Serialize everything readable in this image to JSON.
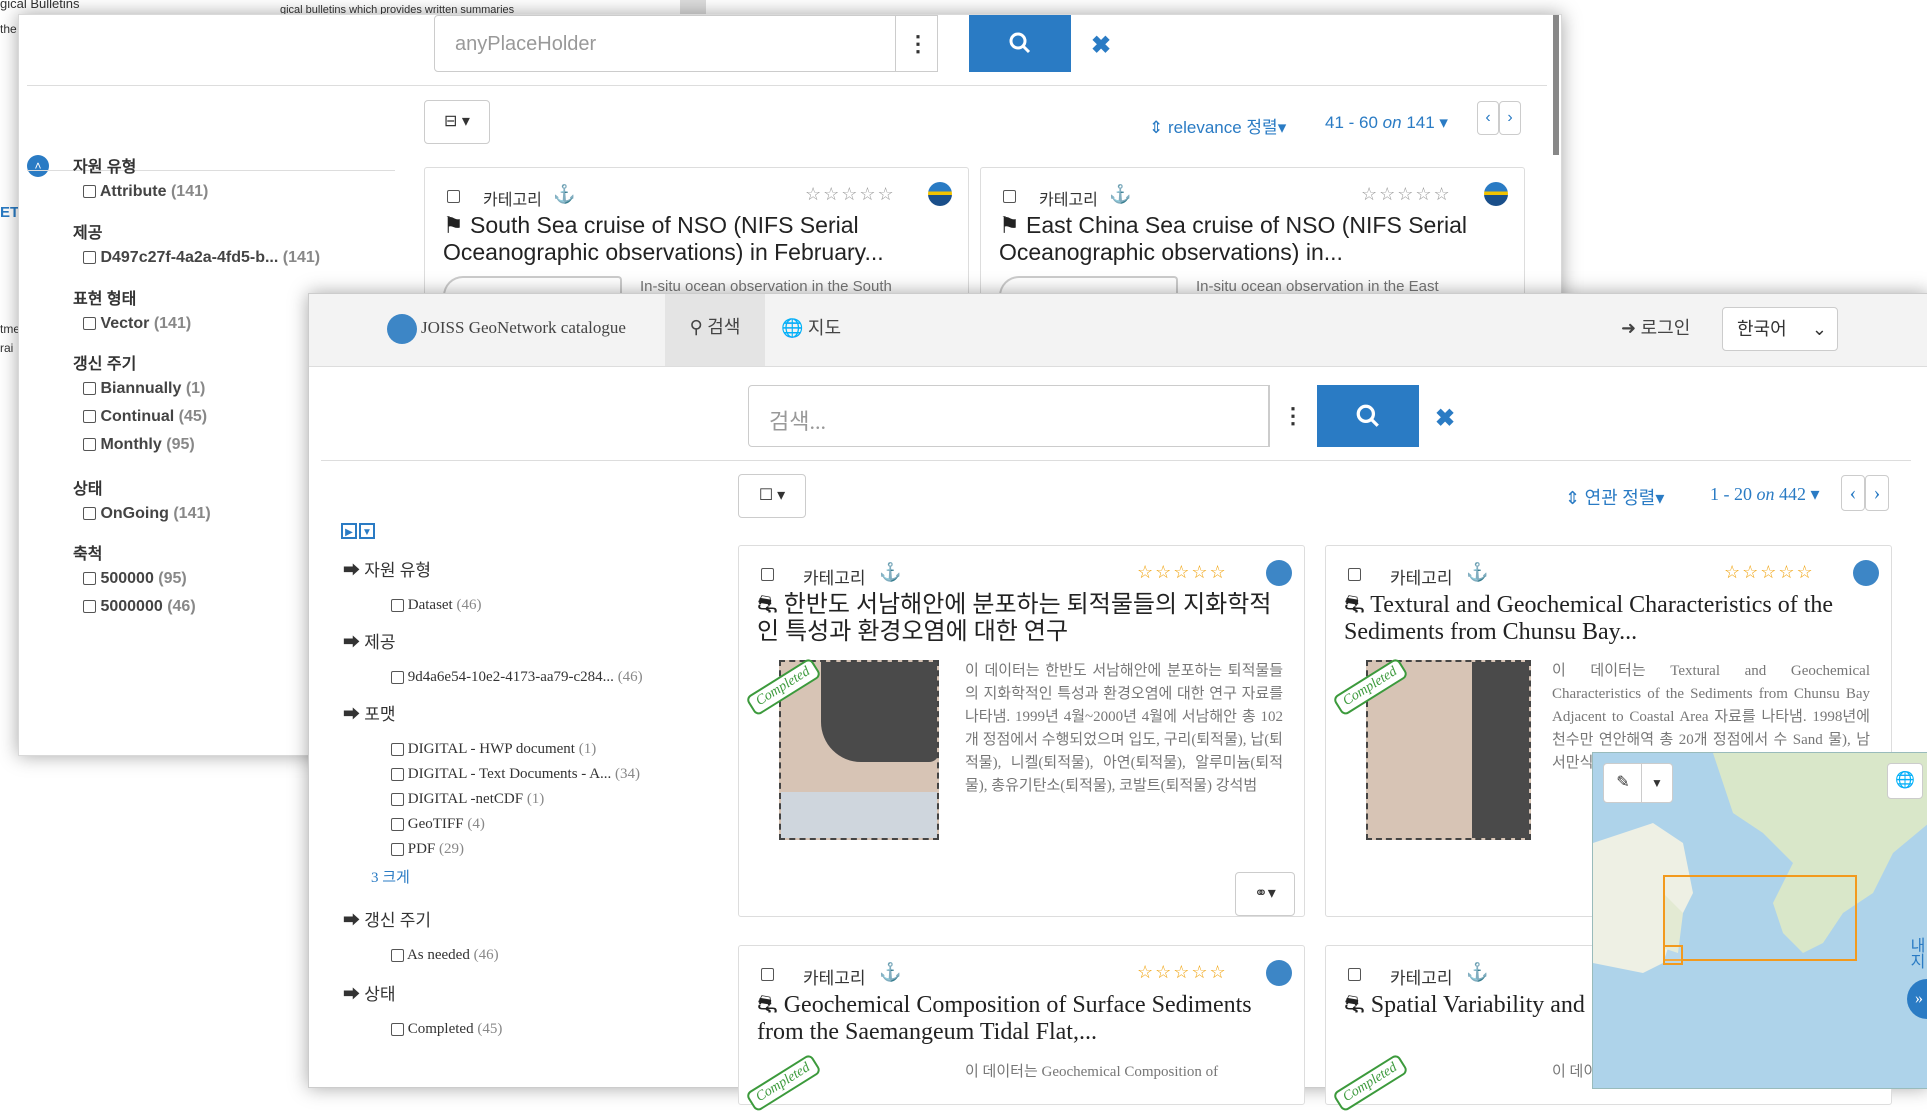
{
  "background": {
    "title_fragment": "gical Bulletins",
    "desc_fragment": "gical bulletins which provides written summaries",
    "left_fragments": [
      "the",
      "ET",
      "tme",
      "rai"
    ]
  },
  "back": {
    "search_placeholder": "anyPlaceHolder",
    "sort_label": "relevance 정렬",
    "paging": "41 - 60",
    "paging_on": "on",
    "paging_total": "141",
    "facets": [
      {
        "title": "자원 유형",
        "items": [
          {
            "label": "Attribute",
            "count": "(141)"
          }
        ]
      },
      {
        "title": "제공",
        "items": [
          {
            "label": "D497c27f-4a2a-4fd5-b...",
            "count": "(141)"
          }
        ]
      },
      {
        "title": "표현 형태",
        "items": [
          {
            "label": "Vector",
            "count": "(141)"
          }
        ]
      },
      {
        "title": "갱신 주기",
        "items": [
          {
            "label": "Biannually",
            "count": "(1)"
          },
          {
            "label": "Continual",
            "count": "(45)"
          },
          {
            "label": "Monthly",
            "count": "(95)"
          }
        ]
      },
      {
        "title": "상태",
        "items": [
          {
            "label": "OnGoing",
            "count": "(141)"
          }
        ]
      },
      {
        "title": "축척",
        "items": [
          {
            "label": "500000",
            "count": "(95)"
          },
          {
            "label": "5000000",
            "count": "(46)"
          }
        ]
      }
    ],
    "cards": [
      {
        "category": "카테고리",
        "title": "South Sea cruise of NSO (NIFS Serial Oceanographic observations) in February...",
        "abstract": "In-situ ocean observation in the South"
      },
      {
        "category": "카테고리",
        "title": "East China Sea cruise of NSO (NIFS Serial Oceanographic observations) in...",
        "abstract": "In-situ ocean observation in the East"
      }
    ]
  },
  "front": {
    "brand": "JOISS GeoNetwork catalogue",
    "nav_search": "검색",
    "nav_map": "지도",
    "login": "로그인",
    "language": "한국어",
    "search_placeholder": "검색...",
    "sort_label": "연관 정렬",
    "paging": "1 - 20",
    "paging_on": "on",
    "paging_total": "442",
    "facets": [
      {
        "title": "자원 유형",
        "items": [
          {
            "label": "Dataset",
            "count": "(46)"
          }
        ]
      },
      {
        "title": "제공",
        "items": [
          {
            "label": "9d4a6e54-10e2-4173-aa79-c284...",
            "count": "(46)"
          }
        ]
      },
      {
        "title": "포맷",
        "items": [
          {
            "label": "DIGITAL - HWP document",
            "count": "(1)"
          },
          {
            "label": "DIGITAL - Text Documents - A...",
            "count": "(34)"
          },
          {
            "label": "DIGITAL -netCDF",
            "count": "(1)"
          },
          {
            "label": "GeoTIFF",
            "count": "(4)"
          },
          {
            "label": "PDF",
            "count": "(29)"
          }
        ],
        "more": "3 크게"
      },
      {
        "title": "갱신 주기",
        "items": [
          {
            "label": "As needed",
            "count": "(46)"
          }
        ]
      },
      {
        "title": "상태",
        "items": [
          {
            "label": "Completed",
            "count": "(45)"
          }
        ]
      }
    ],
    "cards": [
      {
        "category": "카테고리",
        "title": "한반도 서남해안에 분포하는 퇴적물들의 지화학적인 특성과 환경오염에 대한 연구",
        "badge": "Completed",
        "abstract": "이 데이터는 한반도 서남해안에 분포하는 퇴적물들의 지화학적인 특성과 환경오염에 대한 연구 자료를 나타냄. 1999년 4월~2000년 4월에 서남해안 총 102개 정점에서 수행되었으며 입도, 구리(퇴적물), 납(퇴적물), 니켈(퇴적물), 아연(퇴적물), 알루미늄(퇴적물), 총유기탄소(퇴적물), 코발트(퇴적물) 강석범"
      },
      {
        "category": "카테고리",
        "title": "Textural and Geochemical Characteristics of the Sediments from Chunsu Bay...",
        "badge": "Completed",
        "abstract": "이 데이터는 Textural and Geochemical Characteristics of the Sediments from Chunsu Bay Adjacent to Coastal Area 자료를 나타냄. 1998년에 천수만 연안해역 총 20개 정점에서 수 Sand 물), 남 서만식"
      },
      {
        "category": "카테고리",
        "title": "Geochemical Composition of Surface Sediments from the Saemangeum Tidal Flat,...",
        "badge": "Completed",
        "abstract": "이 데이터는 Geochemical Composition of"
      },
      {
        "category": "카테고리",
        "title": "Spatial Variability and Surficial Sediments of...",
        "badge": "Completed",
        "abstract": "이 데이"
      }
    ],
    "map_side_label": "내지"
  },
  "colors": {
    "accent": "#2a7bc4",
    "star_gold": "#f0a20b",
    "completed_green": "#3c9a3c",
    "sea": "#aed3ea",
    "land": "#d7c4b5"
  }
}
